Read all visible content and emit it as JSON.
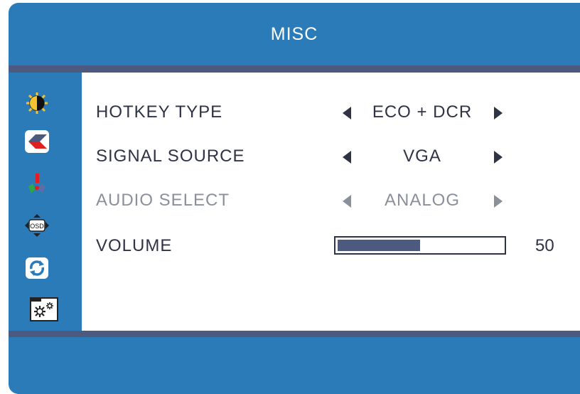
{
  "title": "MISC",
  "sidebar": {
    "icons": [
      {
        "name": "brightness-icon"
      },
      {
        "name": "image-icon"
      },
      {
        "name": "color-icon"
      },
      {
        "name": "osd-icon",
        "text": "OSD"
      },
      {
        "name": "reset-icon"
      },
      {
        "name": "misc-settings-icon",
        "selected": true
      }
    ]
  },
  "menu": {
    "hotkey_type": {
      "label": "HOTKEY  TYPE",
      "value": "ECO + DCR"
    },
    "signal_source": {
      "label": "SIGNAL  SOURCE",
      "value": "VGA"
    },
    "audio_select": {
      "label": "AUDIO  SELECT",
      "value": "ANALOG",
      "disabled": true
    },
    "volume": {
      "label": "VOLUME",
      "value": "50",
      "level_percent": 50
    }
  },
  "colors": {
    "background": "#2a7bb8",
    "divider": "#4b5a7e",
    "text": "#2e3346",
    "disabled_text": "#8a8f9c"
  }
}
